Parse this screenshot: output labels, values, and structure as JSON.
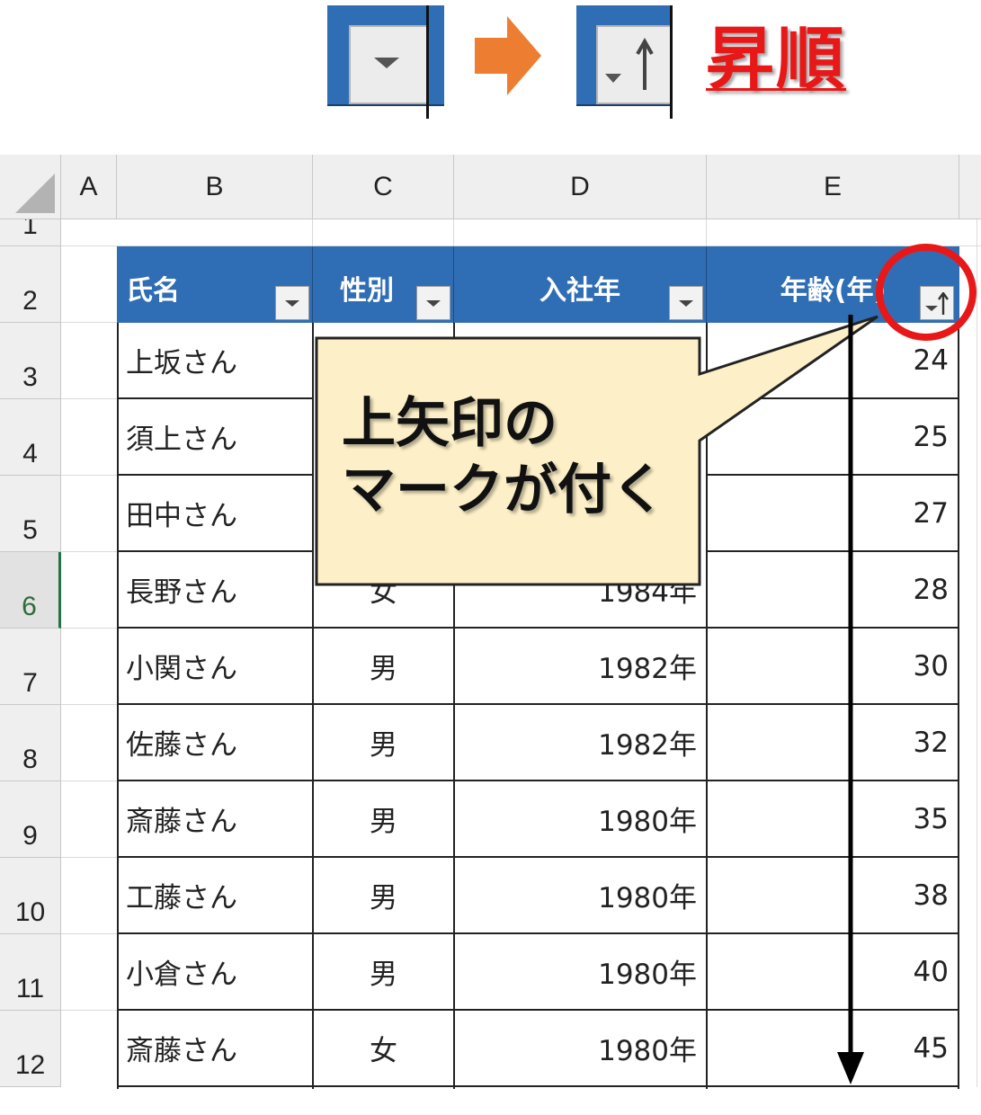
{
  "legend": {
    "before_icon": "dropdown-arrow-icon",
    "transition_icon": "arrow-right-icon",
    "after_icon": "sort-ascending-icon",
    "label": "昇順",
    "label_color": "#e81818"
  },
  "sheet": {
    "columns": [
      "A",
      "B",
      "C",
      "D",
      "E"
    ],
    "rows": [
      "1",
      "2",
      "3",
      "4",
      "5",
      "6",
      "7",
      "8",
      "9",
      "10",
      "11",
      "12"
    ],
    "selected_row": "6",
    "table": {
      "headers": [
        "氏名",
        "性別",
        "入社年",
        "年齢(年)"
      ],
      "rows": [
        [
          "上坂さん",
          "",
          "",
          "24"
        ],
        [
          "須上さん",
          "",
          "",
          "25"
        ],
        [
          "田中さん",
          "",
          "",
          "27"
        ],
        [
          "長野さん",
          "女",
          "1984年",
          "28"
        ],
        [
          "小関さん",
          "男",
          "1982年",
          "30"
        ],
        [
          "佐藤さん",
          "男",
          "1982年",
          "32"
        ],
        [
          "斎藤さん",
          "男",
          "1980年",
          "35"
        ],
        [
          "工藤さん",
          "男",
          "1980年",
          "38"
        ],
        [
          "小倉さん",
          "男",
          "1980年",
          "40"
        ],
        [
          "斎藤さん",
          "女",
          "1980年",
          "45"
        ]
      ]
    }
  },
  "callout": {
    "line1": "上矢印の",
    "line2": "マークが付く",
    "fill": "#fdf0c8"
  },
  "colors": {
    "header_fill": "#2f6eb5",
    "highlight_circle": "#e81818",
    "arrow_orange": "#ed7d31"
  }
}
